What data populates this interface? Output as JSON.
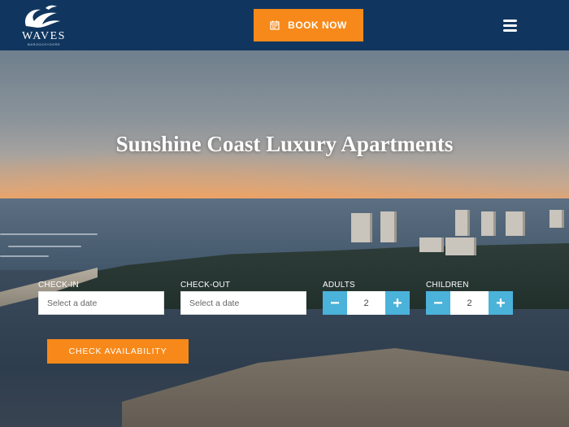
{
  "header": {
    "logo_text": "WAVES",
    "logo_subtext": "MAROOCHYDORE",
    "book_label": "BOOK NOW",
    "colors": {
      "header_bg": "#10365f",
      "accent": "#f7891a"
    }
  },
  "hero": {
    "title": "Sunshine Coast Luxury Apartments"
  },
  "booking": {
    "checkin_label": "CHECK-IN",
    "checkin_placeholder": "Select a date",
    "checkout_label": "CHECK-OUT",
    "checkout_placeholder": "Select a date",
    "adults_label": "ADULTS",
    "adults_value": "2",
    "children_label": "CHILDREN",
    "children_value": "2",
    "minus_symbol": "−",
    "plus_symbol": "+",
    "submit_label": "CHECK AVAILABILITY",
    "colors": {
      "stepper": "#4bb2d9",
      "submit": "#f7891a"
    }
  }
}
